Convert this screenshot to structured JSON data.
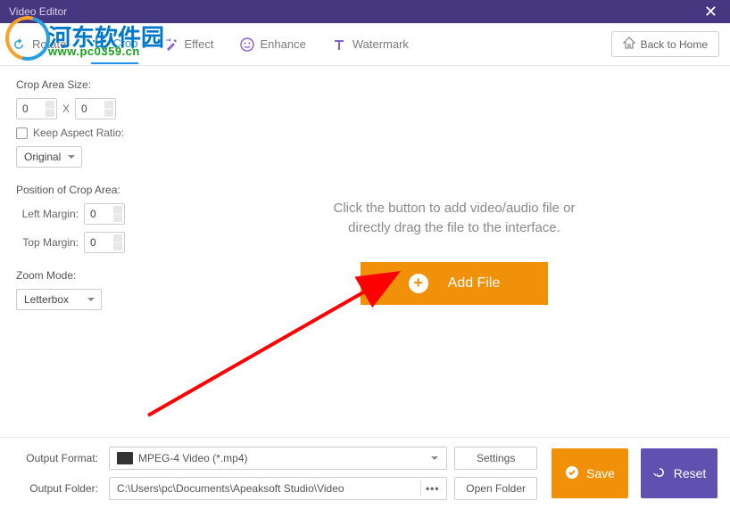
{
  "title": "Video Editor",
  "tabs": {
    "rotate": "Rotate",
    "crop": "Crop",
    "effect": "Effect",
    "enhance": "Enhance",
    "watermark": "Watermark"
  },
  "back_to_home": "Back to Home",
  "sidebar": {
    "crop_area_size": "Crop Area Size:",
    "width": "0",
    "height": "0",
    "keep_aspect": "Keep Aspect Ratio:",
    "ratio_value": "Original",
    "position_title": "Position of Crop Area:",
    "left_margin_label": "Left Margin:",
    "left_margin": "0",
    "top_margin_label": "Top Margin:",
    "top_margin": "0",
    "zoom_title": "Zoom Mode:",
    "zoom_value": "Letterbox"
  },
  "drop": {
    "line1": "Click the button to add video/audio file or",
    "line2": "directly drag the file to the interface.",
    "add_file": "Add File"
  },
  "footer": {
    "format_label": "Output Format:",
    "format_value": "MPEG-4 Video (*.mp4)",
    "settings": "Settings",
    "folder_label": "Output Folder:",
    "folder_value": "C:\\Users\\pc\\Documents\\Apeaksoft Studio\\Video",
    "open_folder": "Open Folder",
    "save": "Save",
    "reset": "Reset"
  },
  "watermark_overlay": {
    "brand": "河东软件园",
    "url": "www.pc0359.cn"
  }
}
